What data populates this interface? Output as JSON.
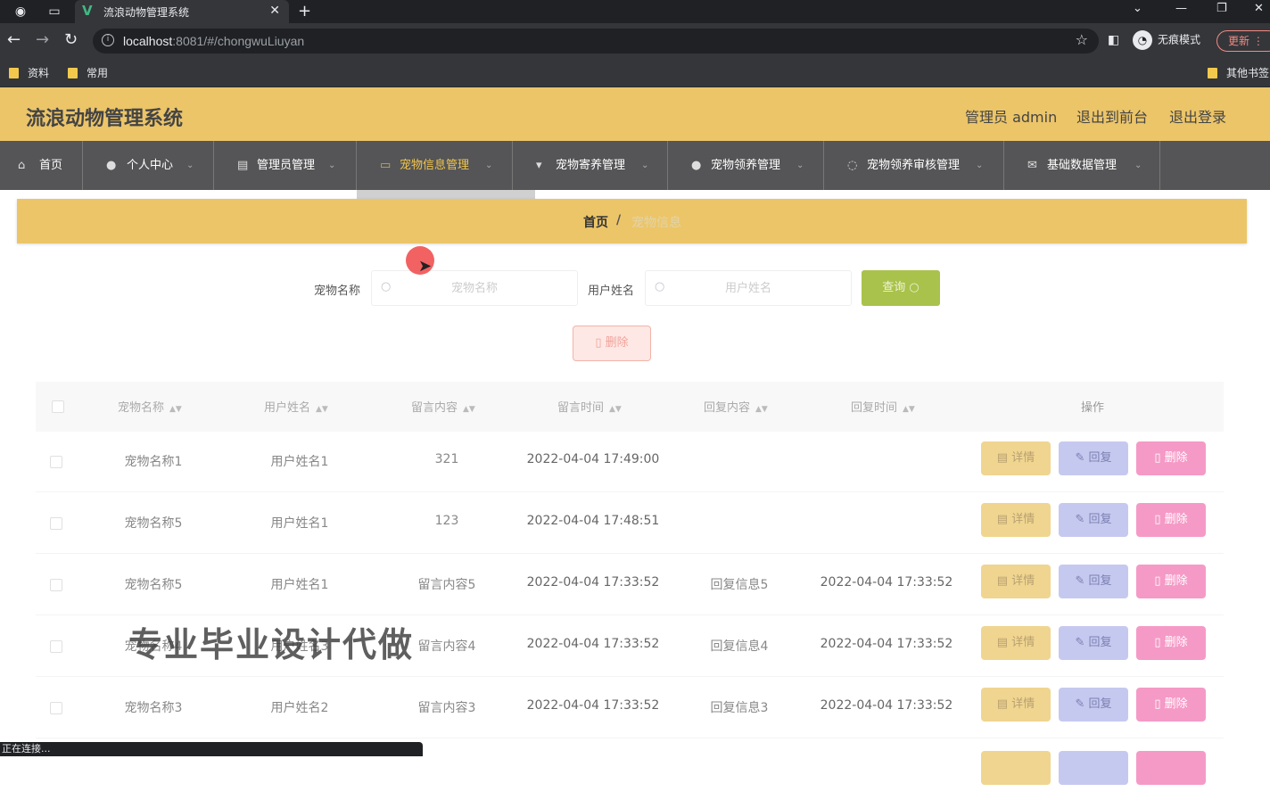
{
  "browser": {
    "tab_title": "流浪动物管理系统",
    "url_host": "localhost",
    "url_rest": ":8081/#/chongwuLiuyan",
    "incognito_label": "无痕模式",
    "update_label": "更新",
    "bookmarks": [
      "资料",
      "常用"
    ],
    "other_bookmarks": "其他书签",
    "status_text": "正在连接..."
  },
  "header": {
    "title": "流浪动物管理系统",
    "admin_label": "管理员 admin",
    "to_front_label": "退出到前台",
    "logout_label": "退出登录"
  },
  "menu": {
    "items": [
      {
        "label": "首页",
        "icon": "home-icon"
      },
      {
        "label": "个人中心",
        "icon": "user-icon"
      },
      {
        "label": "管理员管理",
        "icon": "clipboard-icon"
      },
      {
        "label": "宠物信息管理",
        "icon": "message-icon"
      },
      {
        "label": "宠物寄养管理",
        "icon": "stamp-icon"
      },
      {
        "label": "宠物领养管理",
        "icon": "user-icon"
      },
      {
        "label": "宠物领养审核管理",
        "icon": "power-icon"
      },
      {
        "label": "基础数据管理",
        "icon": "mail-icon"
      }
    ],
    "active_index": 3
  },
  "breadcrumb": {
    "home": "首页",
    "separator": "/",
    "current": "宠物信息"
  },
  "search": {
    "pet_name_label": "宠物名称",
    "pet_name_placeholder": "宠物名称",
    "user_name_label": "用户姓名",
    "user_name_placeholder": "用户姓名",
    "query_label": "查询",
    "delete_label": "删除"
  },
  "table": {
    "headers": [
      "宠物名称",
      "用户姓名",
      "留言内容",
      "留言时间",
      "回复内容",
      "回复时间",
      "操作"
    ],
    "rows": [
      {
        "pet": "宠物名称1",
        "user": "用户姓名1",
        "content": "321",
        "time": "2022-04-04 17:49:00",
        "reply": "",
        "reply_time": ""
      },
      {
        "pet": "宠物名称5",
        "user": "用户姓名1",
        "content": "123",
        "time": "2022-04-04 17:48:51",
        "reply": "",
        "reply_time": ""
      },
      {
        "pet": "宠物名称5",
        "user": "用户姓名1",
        "content": "留言内容5",
        "time": "2022-04-04 17:33:52",
        "reply": "回复信息5",
        "reply_time": "2022-04-04 17:33:52"
      },
      {
        "pet": "宠物名称4",
        "user": "用户姓名3",
        "content": "留言内容4",
        "time": "2022-04-04 17:33:52",
        "reply": "回复信息4",
        "reply_time": "2022-04-04 17:33:52"
      },
      {
        "pet": "宠物名称3",
        "user": "用户姓名2",
        "content": "留言内容3",
        "time": "2022-04-04 17:33:52",
        "reply": "回复信息3",
        "reply_time": "2022-04-04 17:33:52"
      }
    ],
    "actions": {
      "detail": "详情",
      "reply": "回复",
      "delete": "删除"
    }
  },
  "watermark": "专业毕业设计代做",
  "colors": {
    "header_bg": "#ecc569",
    "menu_bg": "#555557",
    "query_btn": "#a9c24b",
    "detail_btn": "#f0d590",
    "reply_btn": "#c6c9ef",
    "delete_btn": "#f59ac6"
  }
}
